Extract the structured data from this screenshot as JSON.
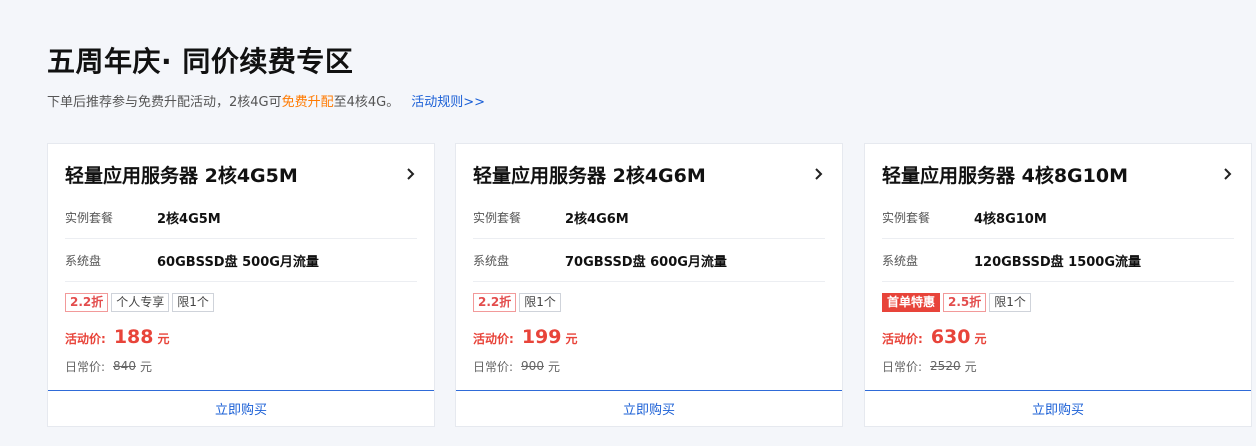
{
  "header": {
    "title": "五周年庆· 同价续费专区",
    "subtitle_pre": "下单后推荐参与免费升配活动，2核4G可",
    "subtitle_highlight": "免费升配",
    "subtitle_post": "至4核4G。",
    "rules_link": "活动规则>>"
  },
  "colors": {
    "accent_blue": "#1a5fd6",
    "price_red": "#e8443a",
    "highlight_orange": "#ff7a00"
  },
  "labels": {
    "instance": "实例套餐",
    "disk": "系统盘",
    "activity_price": "活动价:",
    "regular_price": "日常价:",
    "currency": "元",
    "buy": "立即购买"
  },
  "cards": [
    {
      "title": "轻量应用服务器 2核4G5M",
      "instance": "2核4G5M",
      "disk": "60GBSSD盘 500G月流量",
      "tags": [
        "2.2折",
        "个人专享",
        "限1个"
      ],
      "price": "188",
      "regular": "840"
    },
    {
      "title": "轻量应用服务器 2核4G6M",
      "instance": "2核4G6M",
      "disk": "70GBSSD盘 600G月流量",
      "tags": [
        "2.2折",
        "限1个"
      ],
      "price": "199",
      "regular": "900"
    },
    {
      "title": "轻量应用服务器 4核8G10M",
      "instance": "4核8G10M",
      "disk": "120GBSSD盘 1500G流量",
      "tags": [
        "首单特惠",
        "2.5折",
        "限1个"
      ],
      "price": "630",
      "regular": "2520"
    }
  ]
}
